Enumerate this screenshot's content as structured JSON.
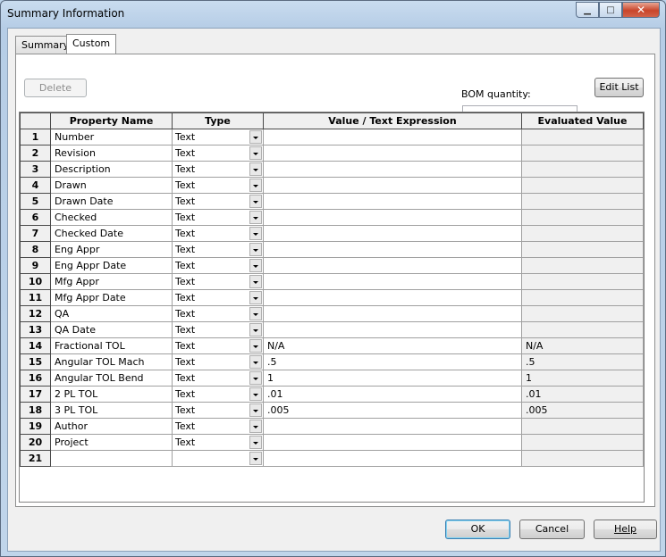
{
  "window": {
    "title": "Summary Information"
  },
  "tabs": [
    {
      "label": "Summary"
    },
    {
      "label": "Custom"
    }
  ],
  "delete_label": "Delete",
  "bom": {
    "label": "BOM quantity:",
    "value": ""
  },
  "edit_list_label": "Edit List",
  "table": {
    "columns": [
      "Property Name",
      "Type",
      "Value / Text Expression",
      "Evaluated Value"
    ],
    "rows": [
      {
        "num": "1",
        "name": "Number",
        "type": "Text",
        "value": "",
        "evaluated": ""
      },
      {
        "num": "2",
        "name": "Revision",
        "type": "Text",
        "value": "",
        "evaluated": ""
      },
      {
        "num": "3",
        "name": "Description",
        "type": "Text",
        "value": "",
        "evaluated": ""
      },
      {
        "num": "4",
        "name": "Drawn",
        "type": "Text",
        "value": "",
        "evaluated": ""
      },
      {
        "num": "5",
        "name": "Drawn Date",
        "type": "Text",
        "value": "",
        "evaluated": ""
      },
      {
        "num": "6",
        "name": "Checked",
        "type": "Text",
        "value": "",
        "evaluated": ""
      },
      {
        "num": "7",
        "name": "Checked Date",
        "type": "Text",
        "value": "",
        "evaluated": ""
      },
      {
        "num": "8",
        "name": "Eng Appr",
        "type": "Text",
        "value": "",
        "evaluated": ""
      },
      {
        "num": "9",
        "name": "Eng Appr Date",
        "type": "Text",
        "value": "",
        "evaluated": ""
      },
      {
        "num": "10",
        "name": "Mfg Appr",
        "type": "Text",
        "value": "",
        "evaluated": ""
      },
      {
        "num": "11",
        "name": "Mfg Appr Date",
        "type": "Text",
        "value": "",
        "evaluated": ""
      },
      {
        "num": "12",
        "name": "QA",
        "type": "Text",
        "value": "",
        "evaluated": ""
      },
      {
        "num": "13",
        "name": "QA Date",
        "type": "Text",
        "value": "",
        "evaluated": ""
      },
      {
        "num": "14",
        "name": "Fractional TOL",
        "type": "Text",
        "value": "N/A",
        "evaluated": "N/A"
      },
      {
        "num": "15",
        "name": "Angular TOL Mach",
        "type": "Text",
        "value": ".5",
        "evaluated": ".5"
      },
      {
        "num": "16",
        "name": "Angular TOL Bend",
        "type": "Text",
        "value": "1",
        "evaluated": "1"
      },
      {
        "num": "17",
        "name": "2 PL TOL",
        "type": "Text",
        "value": ".01",
        "evaluated": ".01"
      },
      {
        "num": "18",
        "name": "3 PL TOL",
        "type": "Text",
        "value": ".005",
        "evaluated": ".005"
      },
      {
        "num": "19",
        "name": "Author",
        "type": "Text",
        "value": "",
        "evaluated": ""
      },
      {
        "num": "20",
        "name": "Project",
        "type": "Text",
        "value": "",
        "evaluated": ""
      },
      {
        "num": "21",
        "name": "",
        "type": "",
        "value": "",
        "evaluated": ""
      }
    ]
  },
  "footer": {
    "ok_label": "OK",
    "cancel_label": "Cancel",
    "help_label": "Help"
  }
}
